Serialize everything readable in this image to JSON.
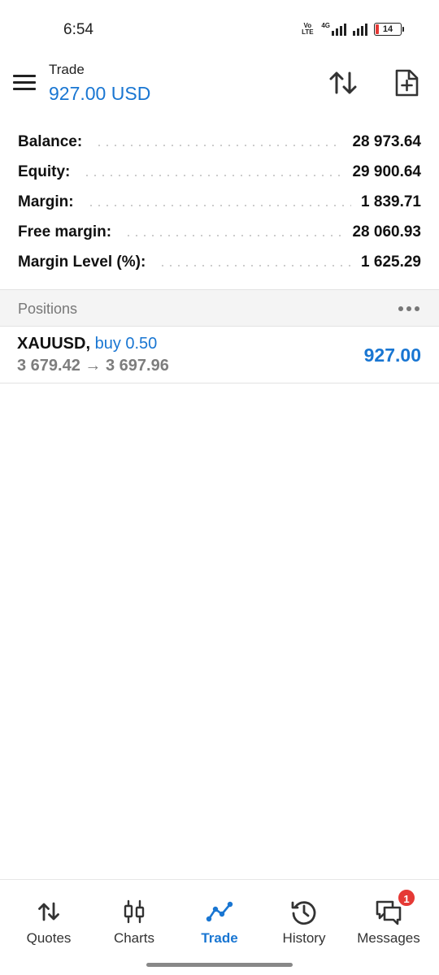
{
  "status_bar": {
    "time": "6:54",
    "volte_label": "Vo\nLTE",
    "network_label": "4G",
    "battery": "14",
    "battery_color": "#e53935"
  },
  "header": {
    "title": "Trade",
    "profit": "927.00 USD",
    "menu_icon": "hamburger-menu-icon",
    "sort_icon": "sort-arrows-icon",
    "new_order_icon": "new-order-document-icon"
  },
  "summary": [
    {
      "label": "Balance:",
      "value": "28 973.64"
    },
    {
      "label": "Equity:",
      "value": "29 900.64"
    },
    {
      "label": "Margin:",
      "value": "1 839.71"
    },
    {
      "label": "Free margin:",
      "value": "28 060.93"
    },
    {
      "label": "Margin Level (%):",
      "value": "1 625.29"
    }
  ],
  "positions": {
    "title": "Positions",
    "items": [
      {
        "symbol": "XAUUSD,",
        "side": "buy 0.50",
        "prices": "3 679.42 → 3 697.96",
        "profit": "927.00"
      }
    ]
  },
  "bottom_nav": {
    "items": [
      {
        "label": "Quotes",
        "icon": "quotes-arrows-icon"
      },
      {
        "label": "Charts",
        "icon": "candlestick-chart-icon"
      },
      {
        "label": "Trade",
        "icon": "trade-line-icon",
        "active": true
      },
      {
        "label": "History",
        "icon": "history-clock-icon"
      },
      {
        "label": "Messages",
        "icon": "messages-chat-icon",
        "badge": "1"
      }
    ]
  },
  "colors": {
    "accent": "#1976d2",
    "badge": "#e53935",
    "section_bg": "#f4f4f4"
  }
}
